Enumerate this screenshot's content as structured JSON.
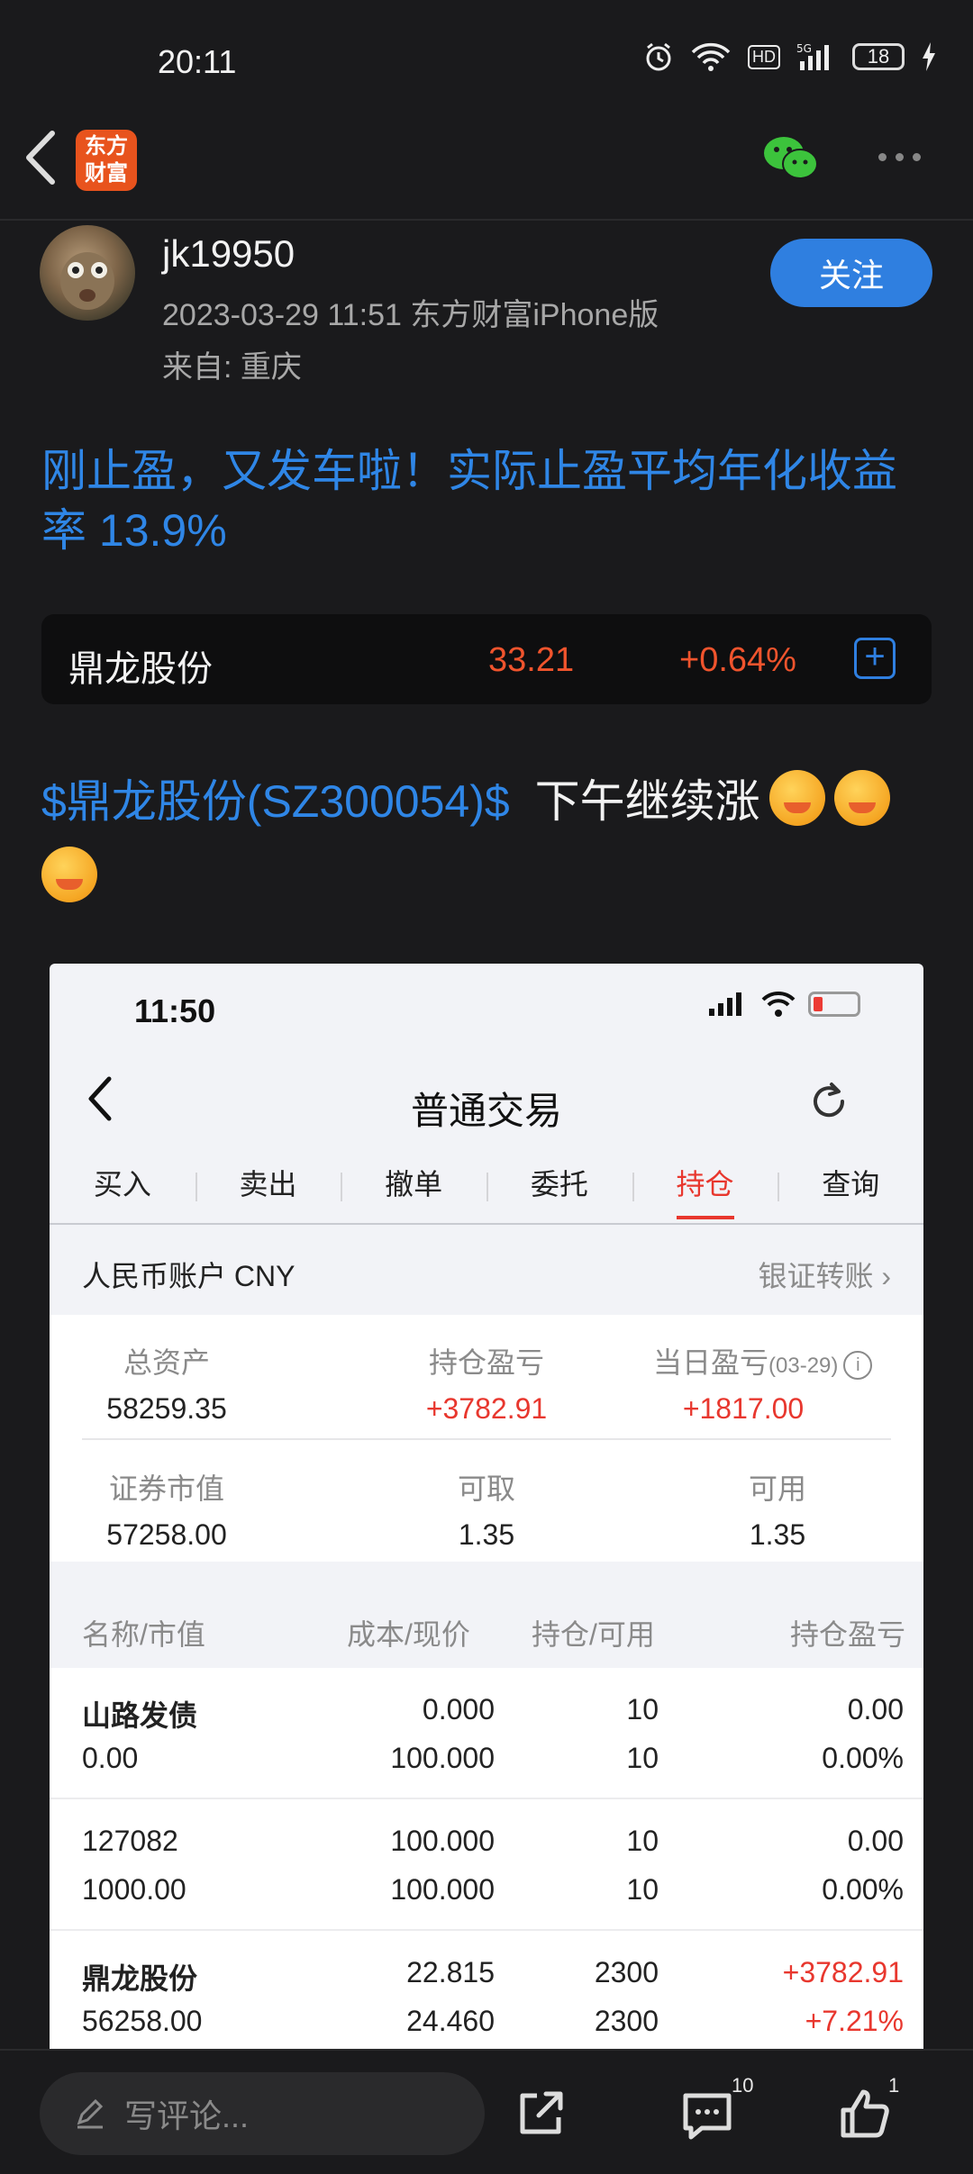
{
  "status_bar": {
    "time": "20:11",
    "battery": "18"
  },
  "header": {
    "logo_line1": "东方",
    "logo_line2": "财富"
  },
  "author": {
    "username": "jk19950",
    "meta": "2023-03-29 11:51 东方财富iPhone版",
    "from": "来自: 重庆",
    "follow_label": "关注"
  },
  "post": {
    "title": "刚止盈，又发车啦！实际止盈平均年化收益率 13.9%",
    "stock_link": "$鼎龙股份(SZ300054)$",
    "text": "下午继续涨"
  },
  "stock_card": {
    "name": "鼎龙股份",
    "price": "33.21",
    "change": "+0.64%"
  },
  "screenshot": {
    "time": "11:50",
    "title": "普通交易",
    "tabs": [
      "买入",
      "卖出",
      "撤单",
      "委托",
      "持仓",
      "查询"
    ],
    "active_tab": "持仓",
    "account_label": "人民币账户 CNY",
    "transfer_label": "银证转账",
    "summary": {
      "total_assets_label": "总资产",
      "total_assets": "58259.35",
      "position_pl_label": "持仓盈亏",
      "position_pl": "+3782.91",
      "daily_pl_label": "当日盈亏",
      "daily_pl_date": "(03-29)",
      "daily_pl": "+1817.00",
      "market_value_label": "证券市值",
      "market_value": "57258.00",
      "withdrawable_label": "可取",
      "withdrawable": "1.35",
      "available_label": "可用",
      "available": "1.35"
    },
    "table_headers": [
      "名称/市值",
      "成本/现价",
      "持仓/可用",
      "持仓盈亏"
    ],
    "rows": [
      {
        "name": "山路发债",
        "value": "0.00",
        "cost": "0.000",
        "price": "100.000",
        "hold": "10",
        "avail": "10",
        "pl": "0.00",
        "pl_pct": "0.00%"
      },
      {
        "name": "127082",
        "value": "1000.00",
        "cost": "100.000",
        "price": "100.000",
        "hold": "10",
        "avail": "10",
        "pl": "0.00",
        "pl_pct": "0.00%"
      },
      {
        "name": "鼎龙股份",
        "value": "56258.00",
        "cost": "22.815",
        "price": "24.460",
        "hold": "2300",
        "avail": "2300",
        "pl": "+3782.91",
        "pl_pct": "+7.21%"
      }
    ]
  },
  "bottom_bar": {
    "comment_placeholder": "写评论...",
    "comment_count": "10",
    "like_count": "1"
  },
  "colors": {
    "accent_blue": "#2f7fe0",
    "up_red": "#f0542d",
    "background": "#1a1a1c"
  }
}
